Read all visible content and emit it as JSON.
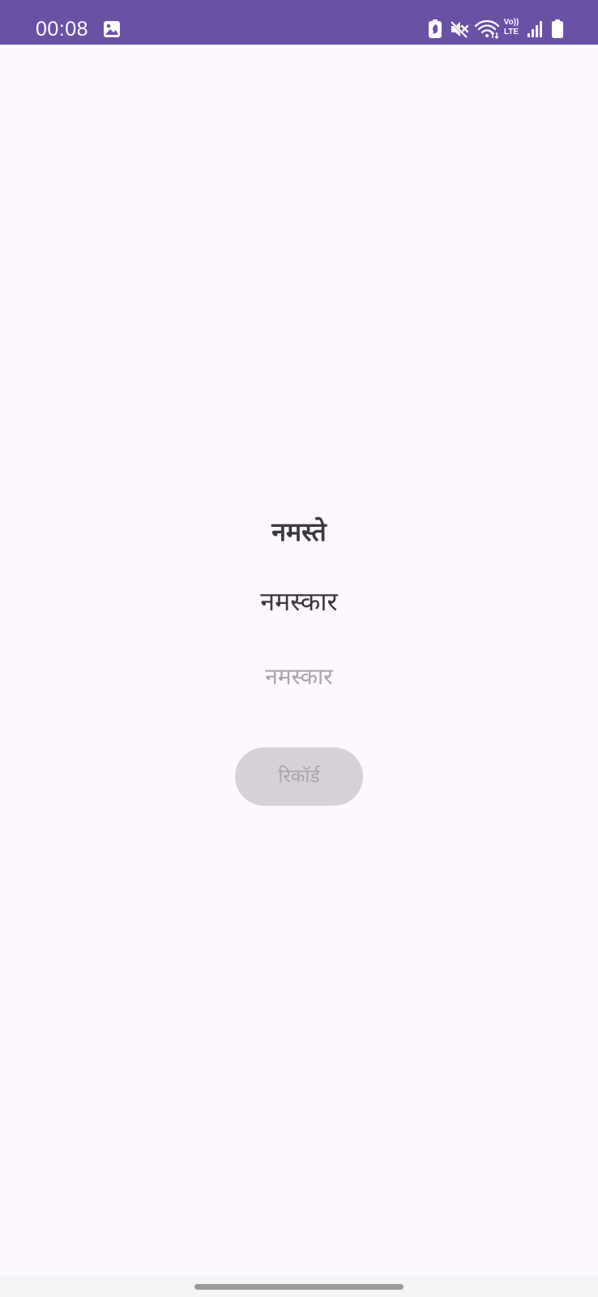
{
  "status_bar": {
    "time": "00:08",
    "background_color": "#6951a5",
    "icons": [
      "gallery-icon",
      "battery-saver-icon",
      "mute-icon",
      "wifi-icon",
      "volte-icon",
      "signal-icon",
      "battery-icon"
    ],
    "volte_line1": "Vo))",
    "volte_line2": "LTE"
  },
  "content": {
    "word_main": "नमस्ते",
    "word_second": "नमस्कार",
    "answer_placeholder": "नमस्कार",
    "answer_value": "",
    "record_label": "रिकॉर्ड"
  },
  "colors": {
    "background": "#fdf7fe",
    "text_primary": "#3a3840",
    "button_disabled_bg": "#d5d1d7",
    "button_disabled_text": "#a7a4ab"
  }
}
